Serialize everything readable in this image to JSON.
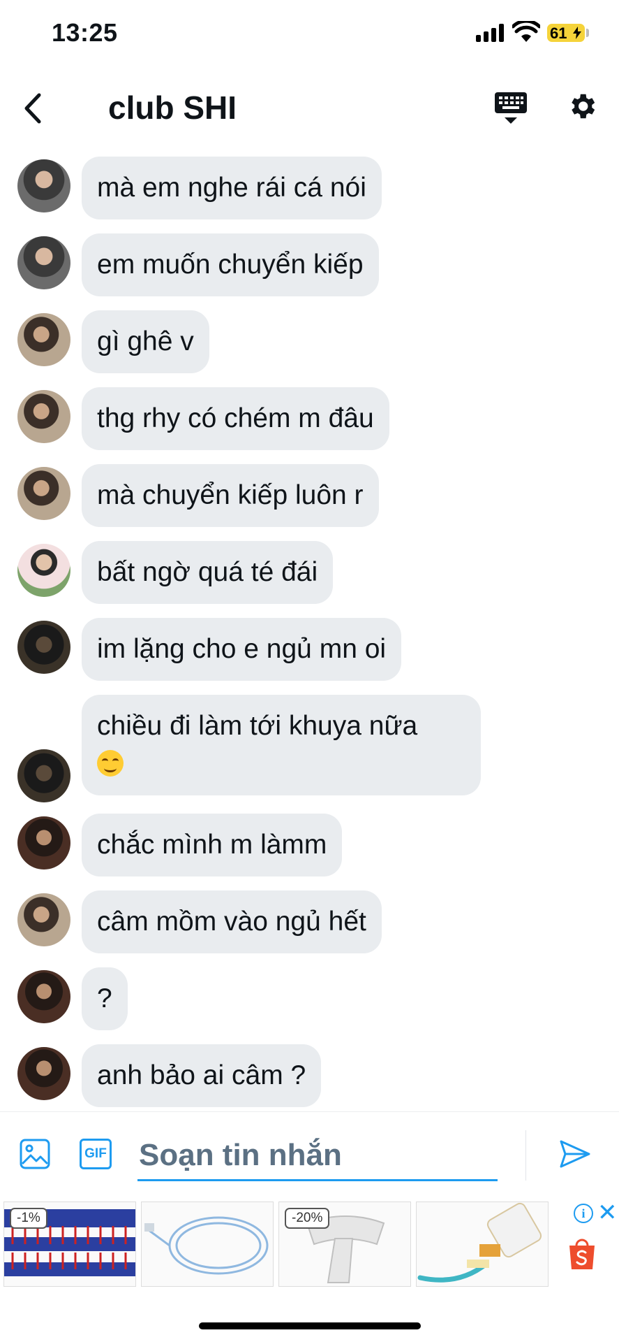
{
  "status_bar": {
    "time": "13:25",
    "battery": "61"
  },
  "header": {
    "title": "club SHI"
  },
  "messages": [
    {
      "text": "mà em nghe rái cá nói",
      "avatar": "avatar-a"
    },
    {
      "text": "em muốn chuyển kiếp",
      "avatar": "avatar-a"
    },
    {
      "text": "gì ghê v",
      "avatar": "avatar-b"
    },
    {
      "text": "thg rhy có chém m đâu",
      "avatar": "avatar-b"
    },
    {
      "text": "mà chuyển kiếp luôn r",
      "avatar": "avatar-b"
    },
    {
      "text": "bất ngờ quá té đái",
      "avatar": "avatar-c"
    },
    {
      "text": "im lặng cho e ngủ mn oi",
      "avatar": "avatar-d"
    },
    {
      "text": "chiều đi làm tới khuya nữa",
      "emoji": "smiling-face",
      "avatar": "avatar-d"
    },
    {
      "text": "chắc mình m làmm",
      "avatar": "avatar-e"
    },
    {
      "text": "câm mồm vào ngủ hết",
      "avatar": "avatar-b"
    },
    {
      "text": "?",
      "avatar": "avatar-e"
    },
    {
      "text": "anh bảo ai câm ?",
      "avatar": "avatar-e"
    }
  ],
  "composer": {
    "placeholder": "Soạn tin nhắn",
    "gif_label": "GIF"
  },
  "ad": {
    "items": [
      {
        "badge": "-1%",
        "icon": "blood-tube-rack"
      },
      {
        "badge": "",
        "icon": "tubing-coil"
      },
      {
        "badge": "-20%",
        "icon": "dental-tray"
      },
      {
        "badge": "",
        "icon": "toothbrush-paste"
      }
    ],
    "info_label": "i",
    "close_label": "✕",
    "brand_icon": "shopee-bag-icon",
    "brand_color": "#ee4d2d"
  },
  "colors": {
    "accent": "#1d9bf0",
    "bubble": "#e9ecef",
    "text": "#0f1419"
  }
}
